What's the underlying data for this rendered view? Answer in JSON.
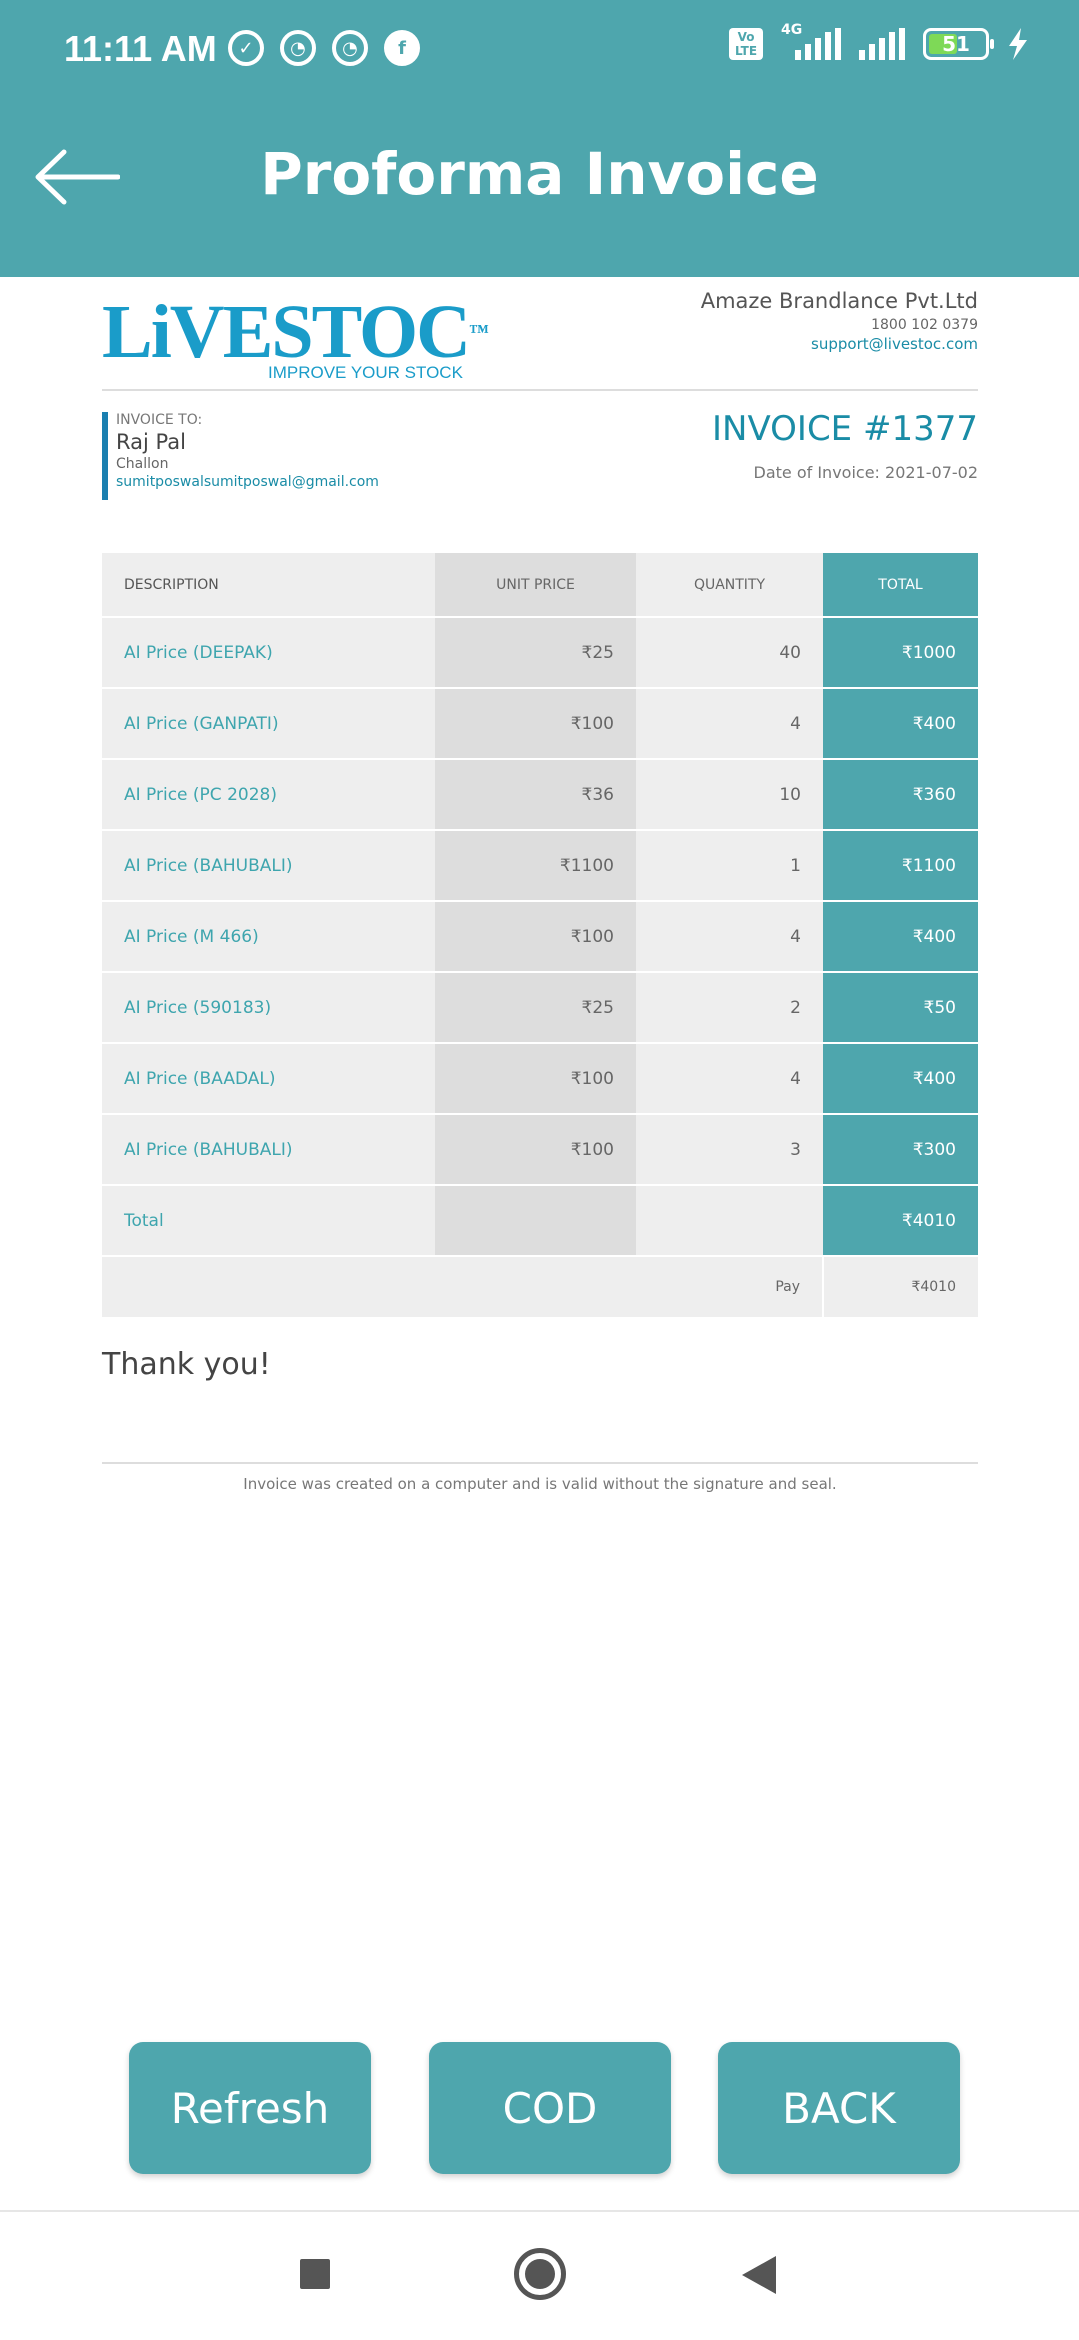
{
  "status": {
    "time": "11:11 AM",
    "network": "4G",
    "volte": "Vo LTE",
    "battery": "51"
  },
  "header": {
    "title": "Proforma Invoice"
  },
  "logo": {
    "text": "LiVESTOC",
    "tm": "™",
    "tagline": "IMPROVE YOUR STOCK"
  },
  "company": {
    "name": "Amaze Brandlance Pvt.Ltd",
    "phone": "1800 102 0379",
    "email": "support@livestoc.com"
  },
  "invoice_to": {
    "label": "INVOICE TO:",
    "name": "Raj Pal",
    "address": "Challon",
    "email": "sumitposwalsumitposwal@gmail.com"
  },
  "invoice": {
    "number": "INVOICE #1377",
    "date": "Date of Invoice: 2021-07-02"
  },
  "table": {
    "headers": [
      "DESCRIPTION",
      "UNIT PRICE",
      "QUANTITY",
      "TOTAL"
    ],
    "rows": [
      {
        "desc": "AI Price (DEEPAK)",
        "unit": "₹25",
        "qty": "40",
        "total": "₹1000"
      },
      {
        "desc": "AI Price (GANPATI)",
        "unit": "₹100",
        "qty": "4",
        "total": "₹400"
      },
      {
        "desc": "AI Price (PC 2028)",
        "unit": "₹36",
        "qty": "10",
        "total": "₹360"
      },
      {
        "desc": "AI Price (BAHUBALI)",
        "unit": "₹1100",
        "qty": "1",
        "total": "₹1100"
      },
      {
        "desc": "AI Price (M 466)",
        "unit": "₹100",
        "qty": "4",
        "total": "₹400"
      },
      {
        "desc": "AI Price (590183)",
        "unit": "₹25",
        "qty": "2",
        "total": "₹50"
      },
      {
        "desc": "AI Price (BAADAL)",
        "unit": "₹100",
        "qty": "4",
        "total": "₹400"
      },
      {
        "desc": "AI Price (BAHUBALI)",
        "unit": "₹100",
        "qty": "3",
        "total": "₹300"
      }
    ],
    "total_label": "Total",
    "total_value": "₹4010",
    "pay_label": "Pay",
    "pay_value": "₹4010"
  },
  "footer": {
    "thanks": "Thank you!",
    "note": "Invoice was created on a computer and is valid without the signature and seal."
  },
  "buttons": {
    "refresh": "Refresh",
    "cod": "COD",
    "back": "BACK"
  },
  "colors": {
    "primary": "#4ea6ad",
    "logo": "#1a9cc9"
  }
}
